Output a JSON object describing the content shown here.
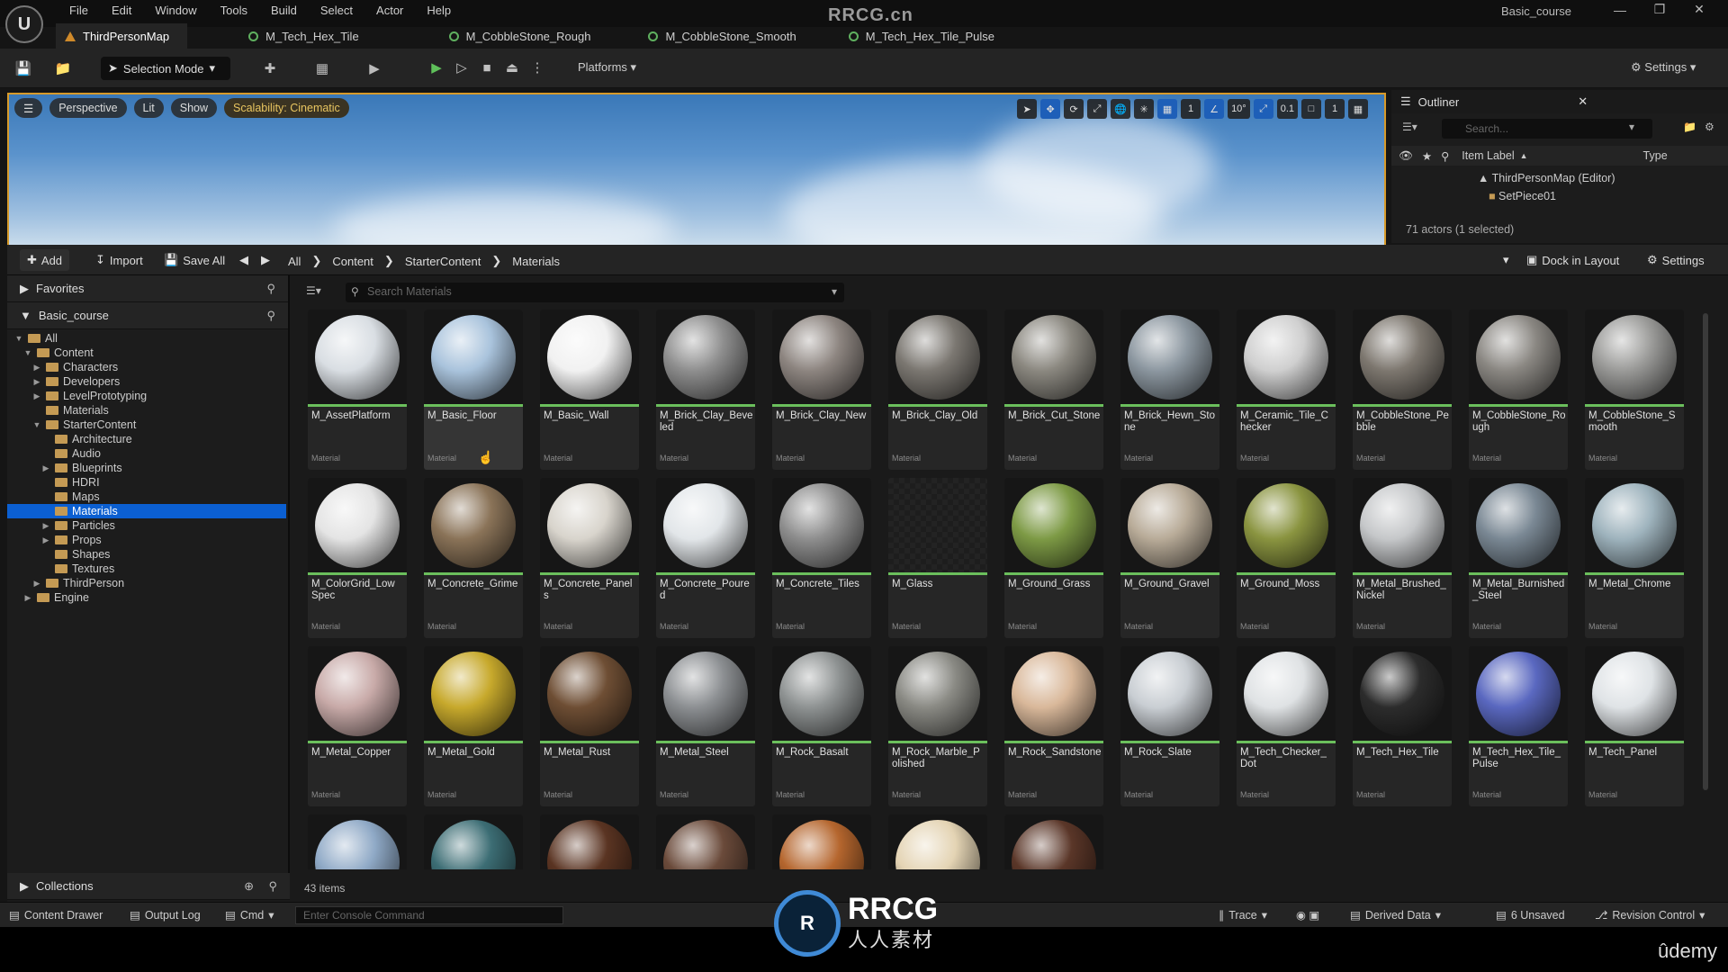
{
  "watermark_top": "RRCG.cn",
  "watermark_bottom": {
    "logo": "R",
    "main": "RRCG",
    "sub": "人人素材"
  },
  "udemy": "ûdemy",
  "menu": [
    "File",
    "Edit",
    "Window",
    "Tools",
    "Build",
    "Select",
    "Actor",
    "Help"
  ],
  "project": "Basic_course",
  "tabs": [
    "ThirdPersonMap",
    "M_Tech_Hex_Tile",
    "M_CobbleStone_Rough",
    "M_CobbleStone_Smooth",
    "M_Tech_Hex_Tile_Pulse"
  ],
  "toolbar": {
    "selection_mode": "Selection Mode",
    "platforms": "Platforms",
    "settings": "Settings"
  },
  "viewport": {
    "perspective": "Perspective",
    "lit": "Lit",
    "show": "Show",
    "scalability": "Scalability: Cinematic",
    "angle": "10°",
    "scale": "0.1",
    "cam": "1",
    "grid": "1"
  },
  "outliner": {
    "title": "Outliner",
    "search": "Search...",
    "col_label": "Item Label",
    "col_type": "Type",
    "row1": "ThirdPersonMap (Editor)",
    "row2": "SetPiece01",
    "footer": "71 actors (1 selected)"
  },
  "cb": {
    "add": "Add",
    "import": "Import",
    "save_all": "Save All",
    "dock": "Dock in Layout",
    "settings": "Settings",
    "path": [
      "All",
      "Content",
      "StarterContent",
      "Materials"
    ],
    "search": "Search Materials",
    "count": "43 items"
  },
  "sidebar": {
    "favorites": "Favorites",
    "project": "Basic_course",
    "collections": "Collections",
    "tree": [
      {
        "label": "All",
        "depth": 0,
        "open": true
      },
      {
        "label": "Content",
        "depth": 1,
        "open": true
      },
      {
        "label": "Characters",
        "depth": 2
      },
      {
        "label": "Developers",
        "depth": 2
      },
      {
        "label": "LevelPrototyping",
        "depth": 2
      },
      {
        "label": "Materials",
        "depth": 2,
        "leaf": true
      },
      {
        "label": "StarterContent",
        "depth": 2,
        "open": true
      },
      {
        "label": "Architecture",
        "depth": 3,
        "leaf": true
      },
      {
        "label": "Audio",
        "depth": 3,
        "leaf": true
      },
      {
        "label": "Blueprints",
        "depth": 3
      },
      {
        "label": "HDRI",
        "depth": 3,
        "leaf": true
      },
      {
        "label": "Maps",
        "depth": 3,
        "leaf": true
      },
      {
        "label": "Materials",
        "depth": 3,
        "leaf": true,
        "selected": true
      },
      {
        "label": "Particles",
        "depth": 3
      },
      {
        "label": "Props",
        "depth": 3
      },
      {
        "label": "Shapes",
        "depth": 3,
        "leaf": true
      },
      {
        "label": "Textures",
        "depth": 3,
        "leaf": true
      },
      {
        "label": "ThirdPerson",
        "depth": 2
      },
      {
        "label": "Engine",
        "depth": 1
      }
    ]
  },
  "asset_type": "Material",
  "assets": [
    {
      "name": "M_AssetPlatform",
      "color": "#d9dee3"
    },
    {
      "name": "M_Basic_Floor",
      "color": "#a9c3dc",
      "selected": true
    },
    {
      "name": "M_Basic_Wall",
      "color": "#f1f1f1"
    },
    {
      "name": "M_Brick_Clay_Beveled",
      "color": "#8e8e8e"
    },
    {
      "name": "M_Brick_Clay_New",
      "color": "#8d8580"
    },
    {
      "name": "M_Brick_Clay_Old",
      "color": "#7b7771"
    },
    {
      "name": "M_Brick_Cut_Stone",
      "color": "#8b8880"
    },
    {
      "name": "M_Brick_Hewn_Stone",
      "color": "#8c97a0"
    },
    {
      "name": "M_Ceramic_Tile_Checker",
      "color": "#cfcfcf"
    },
    {
      "name": "M_CobbleStone_Pebble",
      "color": "#7d776f"
    },
    {
      "name": "M_CobbleStone_Rough",
      "color": "#8a8782"
    },
    {
      "name": "M_CobbleStone_Smooth",
      "color": "#9a9a98"
    },
    {
      "name": "M_ColorGrid_Low Spec",
      "color": "#e4e4e4"
    },
    {
      "name": "M_Concrete_Grime",
      "color": "#8a7358"
    },
    {
      "name": "M_Concrete_Panels",
      "color": "#d8d4cc"
    },
    {
      "name": "M_Concrete_Poured",
      "color": "#e2e6e9"
    },
    {
      "name": "M_Concrete_Tiles",
      "color": "#8e8e8e"
    },
    {
      "name": "M_Glass",
      "color": "transparent"
    },
    {
      "name": "M_Ground_Grass",
      "color": "#7d9a45"
    },
    {
      "name": "M_Ground_Gravel",
      "color": "#b8ab98"
    },
    {
      "name": "M_Ground_Moss",
      "color": "#8a9440"
    },
    {
      "name": "M_Metal_Brushed_Nickel",
      "color": "#c5c7c9"
    },
    {
      "name": "M_Metal_Burnished_Steel",
      "color": "#7a8894"
    },
    {
      "name": "M_Metal_Chrome",
      "color": "#9eb3bd"
    },
    {
      "name": "M_Metal_Copper",
      "color": "#c8aaa8"
    },
    {
      "name": "M_Metal_Gold",
      "color": "#c7a92c"
    },
    {
      "name": "M_Metal_Rust",
      "color": "#6e4e34"
    },
    {
      "name": "M_Metal_Steel",
      "color": "#8c8f92"
    },
    {
      "name": "M_Rock_Basalt",
      "color": "#8e9292"
    },
    {
      "name": "M_Rock_Marble_Polished",
      "color": "#8a8a84"
    },
    {
      "name": "M_Rock_Sandstone",
      "color": "#d9b89a"
    },
    {
      "name": "M_Rock_Slate",
      "color": "#c9ced3"
    },
    {
      "name": "M_Tech_Checker_Dot",
      "color": "#dfe2e4"
    },
    {
      "name": "M_Tech_Hex_Tile",
      "color": "#2c2c2c"
    },
    {
      "name": "M_Tech_Hex_Tile_Pulse",
      "color": "#5a68c0"
    },
    {
      "name": "M_Tech_Panel",
      "color": "#dfe3e6"
    },
    {
      "name": "",
      "color": "#8fa9c6"
    },
    {
      "name": "",
      "color": "#3c6d74"
    },
    {
      "name": "",
      "color": "#5a3422"
    },
    {
      "name": "",
      "color": "#6a4a3a"
    },
    {
      "name": "",
      "color": "#b5662e"
    },
    {
      "name": "",
      "color": "#e4d4b4"
    },
    {
      "name": "",
      "color": "#5a3628"
    }
  ],
  "status": {
    "content_drawer": "Content Drawer",
    "output_log": "Output Log",
    "cmd": "Cmd",
    "console": "Enter Console Command",
    "trace": "Trace",
    "derived": "Derived Data",
    "unsaved": "6 Unsaved",
    "revision": "Revision Control"
  }
}
